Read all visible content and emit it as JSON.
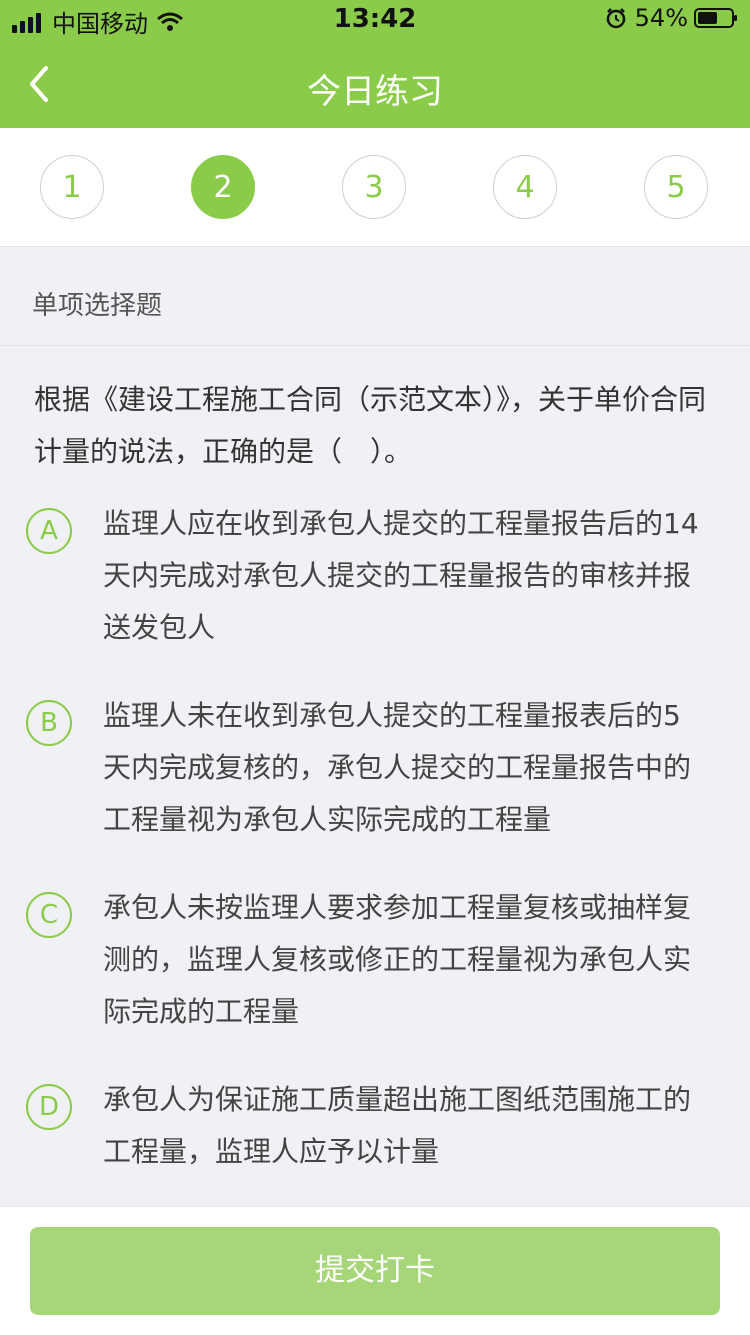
{
  "status_bar": {
    "carrier": "中国移动",
    "time": "13:42",
    "battery_percent": "54%",
    "icons": [
      "signal-icon",
      "wifi-icon",
      "alarm-icon",
      "battery-icon"
    ]
  },
  "nav": {
    "title": "今日练习",
    "back_icon": "chevron-left-icon"
  },
  "steps": [
    "1",
    "2",
    "3",
    "4",
    "5"
  ],
  "active_step": "2",
  "section_title": "单项选择题",
  "question": "根据《建设工程施工合同（示范文本）》，关于单价合同计量的说法，正确的是（　）。",
  "options": [
    {
      "key": "A",
      "text": "监理人应在收到承包人提交的工程量报告后的14天内完成对承包人提交的工程量报告的审核并报送发包人"
    },
    {
      "key": "B",
      "text": "监理人未在收到承包人提交的工程量报表后的5天内完成复核的，承包人提交的工程量报告中的工程量视为承包人实际完成的工程量"
    },
    {
      "key": "C",
      "text": "承包人未按监理人要求参加工程量复核或抽样复测的，监理人复核或修正的工程量视为承包人实际完成的工程量"
    },
    {
      "key": "D",
      "text": "承包人为保证施工质量超出施工图纸范围施工的工程量，监理人应予以计量"
    }
  ],
  "submit_label": "提交打卡",
  "colors": {
    "accent": "#8bcb4a",
    "button_disabled": "#a6d678",
    "background": "#f0f1f4"
  }
}
